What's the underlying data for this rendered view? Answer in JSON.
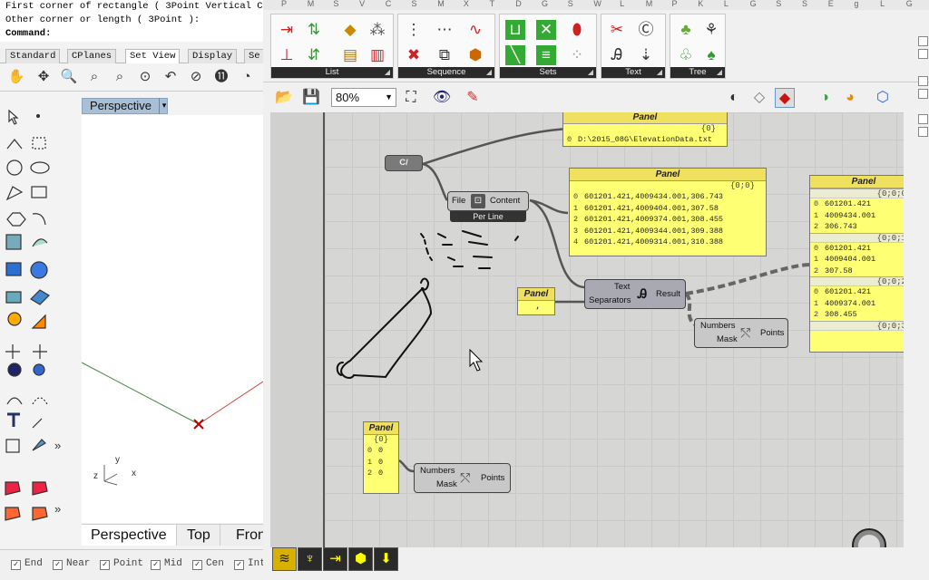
{
  "rhino": {
    "command_lines": [
      "First corner of rectangle ( 3Point  Vertical  Ce",
      "Other corner or length ( 3Point ):",
      "Command:"
    ],
    "toolbar_tabs": [
      "Standard",
      "CPlanes",
      "Set View",
      "Display",
      "Se"
    ],
    "active_tab": "Set View",
    "viewport_title": "Perspective",
    "viewport_tabs": [
      "Perspective",
      "Top",
      "Fron"
    ],
    "axis_labels": {
      "z": "z",
      "y": "y",
      "x": "x"
    },
    "osnaps": [
      "End",
      "Near",
      "Point",
      "Mid",
      "Cen",
      "Int"
    ],
    "more_glyph": "»"
  },
  "grasshopper": {
    "tab_letters": [
      "P",
      "M",
      "S",
      "V",
      "C",
      "S",
      "M",
      "X",
      "T",
      "D",
      "G",
      "S",
      "W",
      "L",
      "M",
      "P",
      "K",
      "L",
      "G",
      "S",
      "S",
      "E",
      "g",
      "L",
      "G"
    ],
    "ribbon_groups": [
      {
        "label": "List",
        "corner": "◢"
      },
      {
        "label": "Sequence",
        "corner": "◢"
      },
      {
        "label": "Sets",
        "corner": "◢"
      },
      {
        "label": "Text",
        "corner": "◢"
      },
      {
        "label": "Tree",
        "corner": "◢"
      }
    ],
    "zoom": "80%",
    "canvas": {
      "file_path_panel": {
        "title": "Panel",
        "path": "{0}",
        "value_index": "0",
        "value": "D:\\2015_08G\\ElevationData.txt"
      },
      "param_label": "C/",
      "file_component": {
        "input": "File",
        "output": "Content",
        "mode": "Per Line"
      },
      "content_panel": {
        "title": "Panel",
        "path": "{0;0}",
        "rows": [
          {
            "i": "0",
            "v": "601201.421,4009434.001,306.743"
          },
          {
            "i": "1",
            "v": "601201.421,4009404.001,307.58"
          },
          {
            "i": "2",
            "v": "601201.421,4009374.001,308.455"
          },
          {
            "i": "3",
            "v": "601201.421,4009344.001,309.388"
          },
          {
            "i": "4",
            "v": "601201.421,4009314.001,310.388"
          }
        ]
      },
      "separator_panel": {
        "title": "Panel",
        "value": ","
      },
      "split_component": {
        "input1": "Text",
        "input2": "Separators",
        "output": "Result"
      },
      "result_panel": {
        "title": "Panel",
        "groups": [
          {
            "path": "{0;0;0",
            "rows": [
              {
                "i": "0",
                "v": "601201.421"
              },
              {
                "i": "1",
                "v": "4009434.001"
              },
              {
                "i": "2",
                "v": "306.743"
              }
            ]
          },
          {
            "path": "{0;0;1",
            "rows": [
              {
                "i": "0",
                "v": "601201.421"
              },
              {
                "i": "1",
                "v": "4009404.001"
              },
              {
                "i": "2",
                "v": "307.58"
              }
            ]
          },
          {
            "path": "{0;0;2",
            "rows": [
              {
                "i": "0",
                "v": "601201.421"
              },
              {
                "i": "1",
                "v": "4009374.001"
              },
              {
                "i": "2",
                "v": "308.455"
              }
            ]
          },
          {
            "path": "{0;0;3",
            "rows": []
          }
        ]
      },
      "point_component_1": {
        "input1": "Numbers",
        "input2": "Mask",
        "output": "Points"
      },
      "small_panel": {
        "title": "Panel",
        "path": "{0}",
        "rows": [
          {
            "i": "0",
            "v": "0"
          },
          {
            "i": "1",
            "v": "0"
          },
          {
            "i": "2",
            "v": "0"
          }
        ]
      },
      "point_component_2": {
        "input1": "Numbers",
        "input2": "Mask",
        "output": "Points"
      }
    }
  }
}
